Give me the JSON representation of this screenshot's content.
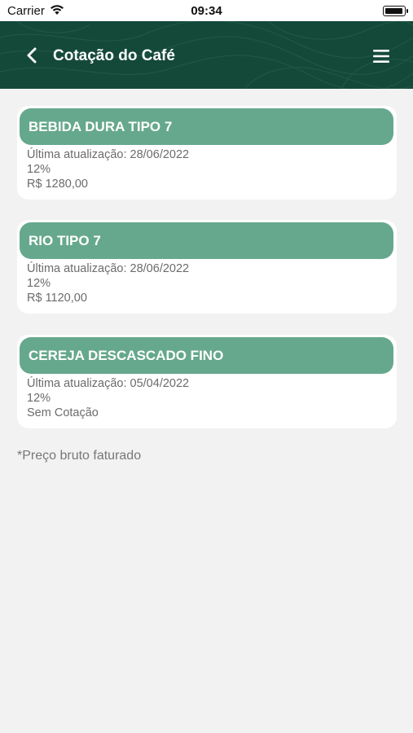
{
  "status_bar": {
    "carrier": "Carrier",
    "time": "09:34",
    "battery_level": 1.0
  },
  "header": {
    "title": "Cotação do Café",
    "back_icon": "chevron-left-icon",
    "menu_icon": "hamburger-menu-icon"
  },
  "colors": {
    "header_bg": "#14493a",
    "card_header_bg": "#66a88d",
    "page_bg": "#f2f2f2"
  },
  "cards": [
    {
      "name": "BEBIDA DURA TIPO 7",
      "updated": "Última atualização: 28/06/2022",
      "percent": "12%",
      "price": "R$ 1280,00"
    },
    {
      "name": "RIO TIPO 7",
      "updated": "Última atualização: 28/06/2022",
      "percent": "12%",
      "price": "R$ 1120,00"
    },
    {
      "name": "CEREJA DESCASCADO FINO",
      "updated": "Última atualização: 05/04/2022",
      "percent": "12%",
      "price": "Sem Cotação"
    }
  ],
  "footnote": "*Preço bruto faturado"
}
